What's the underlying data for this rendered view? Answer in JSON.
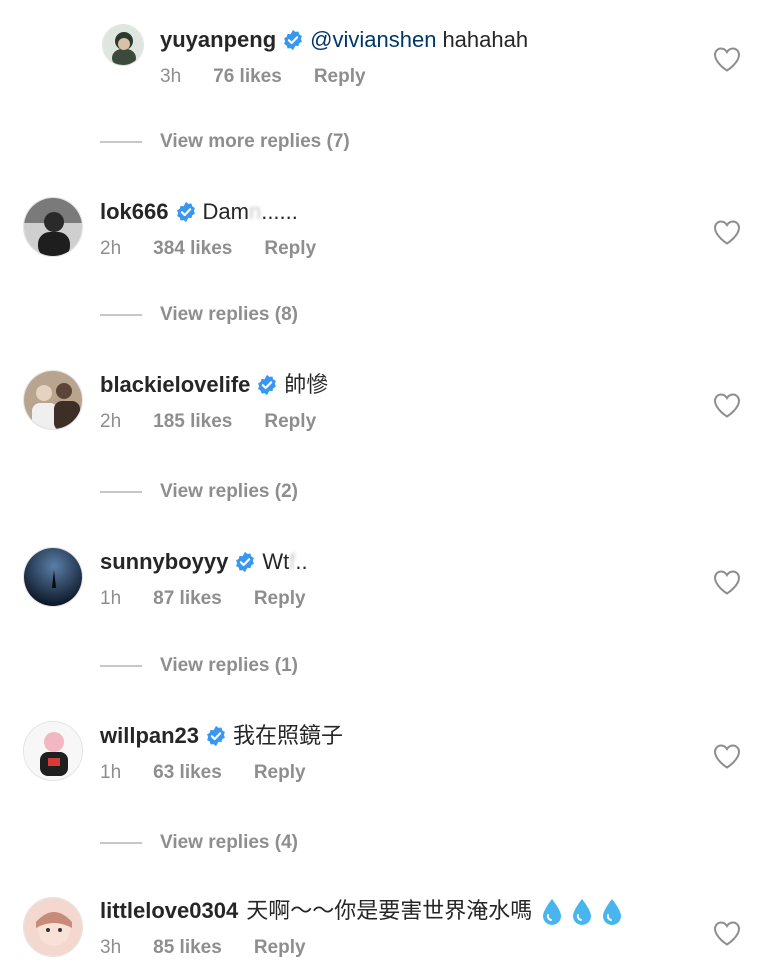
{
  "comments": [
    {
      "username": "yuyanpeng",
      "mention": "@vivianshen",
      "text": "hahahah",
      "time": "3h",
      "likes": "76 likes",
      "reply": "Reply",
      "verified": true,
      "avatar_color": "#2f3a2f"
    },
    {
      "username": "lok666",
      "text": "Dam",
      "text_hidden": "n",
      "text_tail": "......",
      "time": "2h",
      "likes": "384 likes",
      "reply": "Reply",
      "verified": true,
      "avatar_color": "#3a3a3a"
    },
    {
      "username": "blackielovelife",
      "text": "帥慘",
      "time": "2h",
      "likes": "185 likes",
      "reply": "Reply",
      "verified": true,
      "avatar_color": "#8a6b55"
    },
    {
      "username": "sunnyboyyy",
      "text": "Wt",
      "text_hidden": "f",
      "text_tail": "..",
      "time": "1h",
      "likes": "87 likes",
      "reply": "Reply",
      "verified": true,
      "avatar_color": "#0e1a2e"
    },
    {
      "username": "willpan23",
      "text": "我在照鏡子",
      "time": "1h",
      "likes": "63 likes",
      "reply": "Reply",
      "verified": true,
      "avatar_color": "#f3f3f3"
    },
    {
      "username": "littlelove0304",
      "text": "天啊～～你是要害世界淹水嗎",
      "time": "3h",
      "likes": "85 likes",
      "reply": "Reply",
      "verified": false,
      "avatar_color": "#e9b8a6"
    }
  ],
  "view_replies": [
    "View more replies (7)",
    "View replies (8)",
    "View replies (2)",
    "View replies (1)",
    "View replies (4)"
  ],
  "icons": {
    "verified": "verified-badge-icon",
    "heart": "heart-outline-icon",
    "drop": "droplet-emoji-icon"
  },
  "colors": {
    "verified_blue": "#3897f0",
    "meta_gray": "#8e8e8e",
    "mention_blue": "#00376b"
  }
}
